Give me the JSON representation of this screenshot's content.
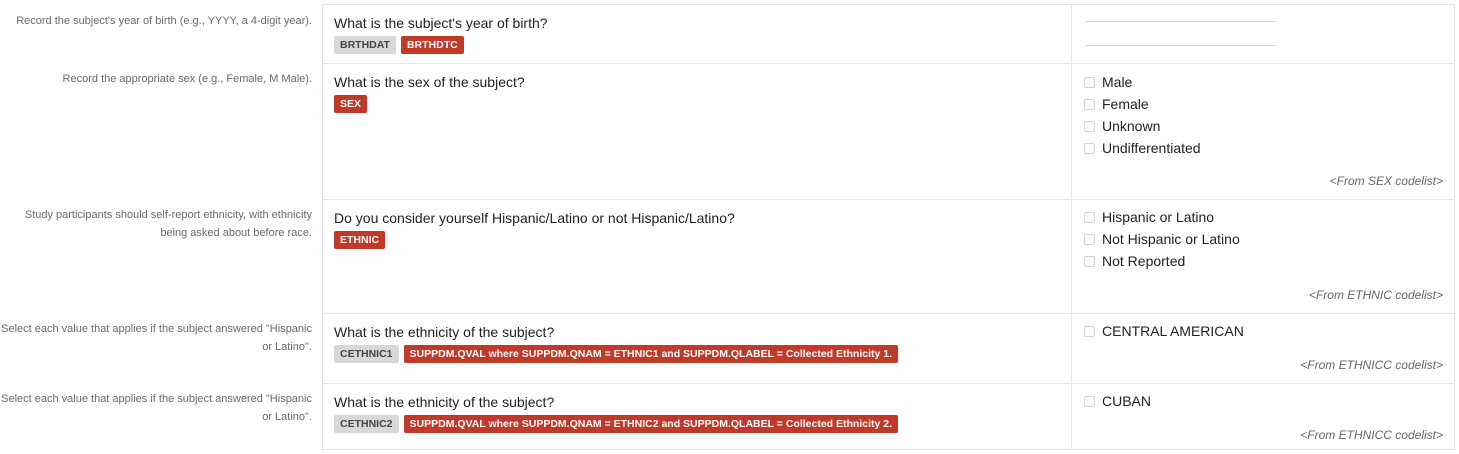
{
  "rows": [
    {
      "help": "Record the subject's year of birth (e.g., YYYY, a 4-digit year).",
      "question": "What is the subject's year of birth?",
      "badges": [
        {
          "text": "BRTHDAT",
          "style": "gray"
        },
        {
          "text": "BRTHDTC",
          "style": "red"
        }
      ],
      "options": [],
      "codelist": ""
    },
    {
      "help": "Record the appropriate sex (e.g., Female, M Male).",
      "question": "What is the sex of the subject?",
      "badges": [
        {
          "text": "SEX",
          "style": "red"
        }
      ],
      "options": [
        "Male",
        "Female",
        "Unknown",
        "Undifferentiated"
      ],
      "codelist": "<From SEX codelist>"
    },
    {
      "help": "Study participants should self-report ethnicity, with ethnicity being asked about before race.",
      "question": "Do you consider yourself Hispanic/Latino or not Hispanic/Latino?",
      "badges": [
        {
          "text": "ETHNIC",
          "style": "red"
        }
      ],
      "options": [
        "Hispanic or Latino",
        "Not Hispanic or Latino",
        "Not Reported"
      ],
      "codelist": "<From ETHNIC codelist>"
    },
    {
      "help": "Select each value that applies if the subject answered \"Hispanic or Latino\".",
      "question": "What is the ethnicity of the subject?",
      "badges": [
        {
          "text": "CETHNIC1",
          "style": "gray"
        },
        {
          "text": "SUPPDM.QVAL where SUPPDM.QNAM = ETHNIC1 and SUPPDM.QLABEL = Collected Ethnicity 1.",
          "style": "red"
        }
      ],
      "options": [
        "CENTRAL AMERICAN"
      ],
      "codelist": "<From ETHNICC codelist>"
    },
    {
      "help": "Select each value that applies if the subject answered \"Hispanic or Latino\".",
      "question": "What is the ethnicity of the subject?",
      "badges": [
        {
          "text": "CETHNIC2",
          "style": "gray"
        },
        {
          "text": "SUPPDM.QVAL where SUPPDM.QNAM = ETHNIC2 and SUPPDM.QLABEL = Collected Ethnicity 2.",
          "style": "red"
        }
      ],
      "options": [
        "CUBAN"
      ],
      "codelist": "<From ETHNICC codelist>"
    }
  ],
  "colors": {
    "red_badge": "#c0392b",
    "gray_badge": "#d8d8d8",
    "border": "#e3e3e3"
  }
}
